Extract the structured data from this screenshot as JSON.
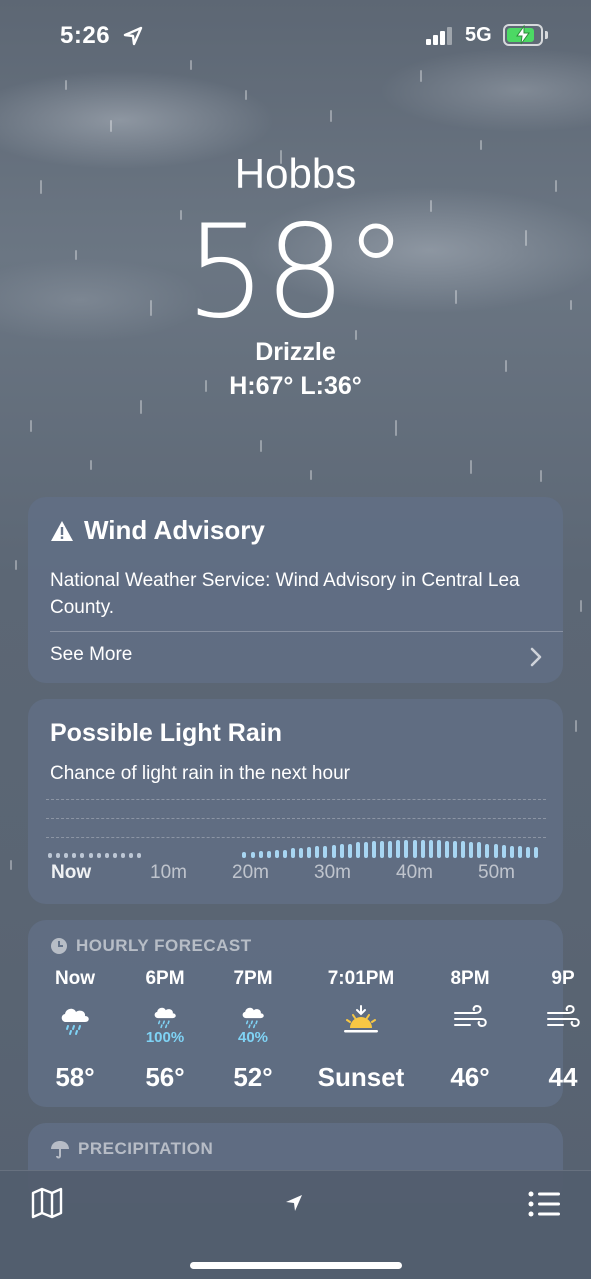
{
  "status_bar": {
    "time": "5:26",
    "network": "5G",
    "battery_level": 0.85,
    "battery_color": "#4cd964"
  },
  "header": {
    "city": "Hobbs",
    "temperature": "58°",
    "condition": "Drizzle",
    "high_low": "H:67°  L:36°"
  },
  "advisory": {
    "title": "Wind Advisory",
    "icon": "warning-icon",
    "body": "National Weather Service: Wind Advisory in Central Lea County.",
    "link_label": "See More"
  },
  "rain_next_hour": {
    "title": "Possible Light Rain",
    "subtitle": "Chance of light rain in the next hour",
    "ticks": [
      "Now",
      "10m",
      "20m",
      "30m",
      "40m",
      "50m"
    ],
    "intensity": [
      0.2,
      0.2,
      0.2,
      0.2,
      0.2,
      0.2,
      0.2,
      0.2,
      0.2,
      0.2,
      0.2,
      0.2,
      0.0,
      0.0,
      0.0,
      0.0,
      0.0,
      0.0,
      0.0,
      0.0,
      0.0,
      0.0,
      0.0,
      0.0,
      0.25,
      0.25,
      0.3,
      0.3,
      0.35,
      0.35,
      0.4,
      0.4,
      0.45,
      0.5,
      0.5,
      0.55,
      0.6,
      0.6,
      0.65,
      0.65,
      0.7,
      0.7,
      0.7,
      0.75,
      0.75,
      0.75,
      0.75,
      0.75,
      0.75,
      0.7,
      0.7,
      0.7,
      0.65,
      0.65,
      0.6,
      0.6,
      0.55,
      0.5,
      0.5,
      0.45,
      0.45
    ]
  },
  "hourly": {
    "heading": "HOURLY FORECAST",
    "items": [
      {
        "label": "Now",
        "icon": "rain-cloud-icon",
        "pop": "",
        "temp": "58°"
      },
      {
        "label": "6PM",
        "icon": "rain-cloud-icon",
        "pop": "100%",
        "temp": "56°"
      },
      {
        "label": "7PM",
        "icon": "rain-cloud-icon",
        "pop": "40%",
        "temp": "52°"
      },
      {
        "label": "7:01PM",
        "icon": "sunset-icon",
        "pop": "",
        "temp": "Sunset"
      },
      {
        "label": "8PM",
        "icon": "wind-icon",
        "pop": "",
        "temp": "46°"
      },
      {
        "label": "9P",
        "icon": "wind-icon",
        "pop": "",
        "temp": "44"
      }
    ]
  },
  "precipitation": {
    "heading": "PRECIPITATION"
  },
  "bottom_bar": {
    "map": "map-icon",
    "location": "location-arrow-icon",
    "list": "list-icon"
  }
}
